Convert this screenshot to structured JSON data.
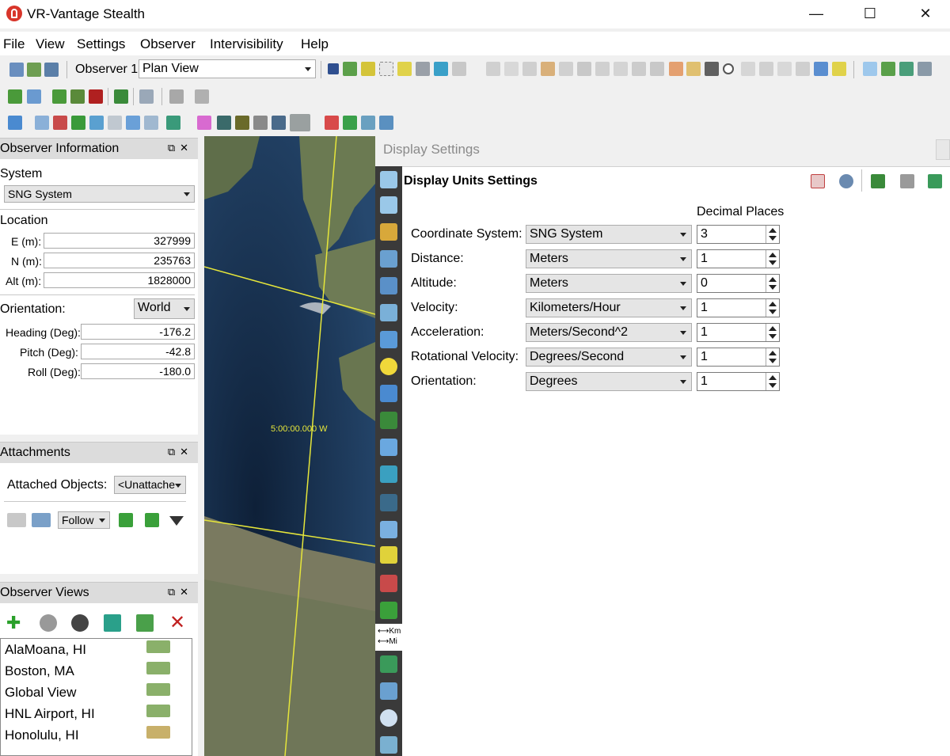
{
  "app": {
    "title": "VR-Vantage Stealth"
  },
  "window_controls": {
    "minimize": "—",
    "maximize": "☐",
    "close": "✕"
  },
  "menubar": [
    "File",
    "View",
    "Settings",
    "Observer",
    "Intervisibility",
    "Help"
  ],
  "toolbar": {
    "observer_label": "Observer 1",
    "view_mode": "Plan View"
  },
  "observer_info": {
    "title": "Observer Information",
    "system_label": "System",
    "system_value": "SNG System",
    "location_label": "Location",
    "e_label": "E (m):",
    "e_value": "327999",
    "n_label": "N (m):",
    "n_value": "235763",
    "alt_label": "Alt (m):",
    "alt_value": "1828000",
    "orientation_label": "Orientation:",
    "orientation_value": "World",
    "heading_label": "Heading (Deg):",
    "heading_value": "-176.2",
    "pitch_label": "Pitch (Deg):",
    "pitch_value": "-42.8",
    "roll_label": "Roll (Deg):",
    "roll_value": "-180.0"
  },
  "attachments": {
    "title": "Attachments",
    "attached_label": "Attached Objects:",
    "attached_value": "<Unattache",
    "mode_value": "Follow"
  },
  "observer_views": {
    "title": "Observer Views",
    "items": [
      "AlaMoana, HI",
      "Boston, MA",
      "Global View",
      "HNL Airport, HI",
      "Honolulu, HI"
    ]
  },
  "map": {
    "longitude_label": "5:00:00.000 W"
  },
  "display_settings": {
    "window_title": "Display Settings",
    "section_title": "Display Units Settings",
    "decimal_header": "Decimal Places",
    "rows": [
      {
        "label": "Coordinate System:",
        "unit": "SNG System",
        "decimals": "3"
      },
      {
        "label": "Distance:",
        "unit": "Meters",
        "decimals": "1"
      },
      {
        "label": "Altitude:",
        "unit": "Meters",
        "decimals": "0"
      },
      {
        "label": "Velocity:",
        "unit": "Kilometers/Hour",
        "decimals": "1"
      },
      {
        "label": "Acceleration:",
        "unit": "Meters/Second^2",
        "decimals": "1"
      },
      {
        "label": "Rotational Velocity:",
        "unit": "Degrees/Second",
        "decimals": "1"
      },
      {
        "label": "Orientation:",
        "unit": "Degrees",
        "decimals": "1"
      }
    ],
    "units_tab_km": "Km",
    "units_tab_mi": "Mi"
  },
  "colors": {
    "accent": "#3b7dd8",
    "map_grid": "#e6e63a",
    "sidebar_dark": "#3a3a3a"
  }
}
